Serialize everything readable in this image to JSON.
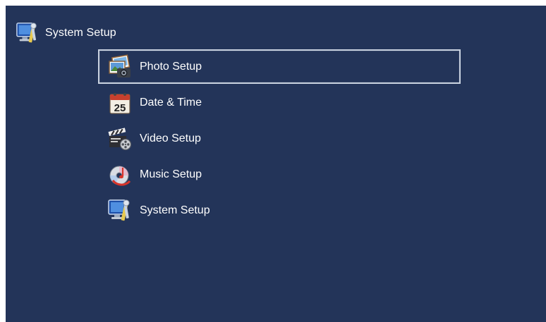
{
  "header": {
    "title": "System Setup",
    "icon": "system-setup-icon"
  },
  "menu": {
    "selected_index": 0,
    "items": [
      {
        "label": "Photo Setup",
        "icon": "photo-setup-icon"
      },
      {
        "label": "Date & Time",
        "icon": "calendar-icon",
        "icon_text": "25"
      },
      {
        "label": "Video Setup",
        "icon": "clapperboard-icon"
      },
      {
        "label": "Music Setup",
        "icon": "music-disc-icon"
      },
      {
        "label": "System Setup",
        "icon": "system-setup-icon"
      }
    ]
  },
  "colors": {
    "background": "#233459",
    "text": "#ffffff",
    "selection_border": "#c9d2e0"
  }
}
